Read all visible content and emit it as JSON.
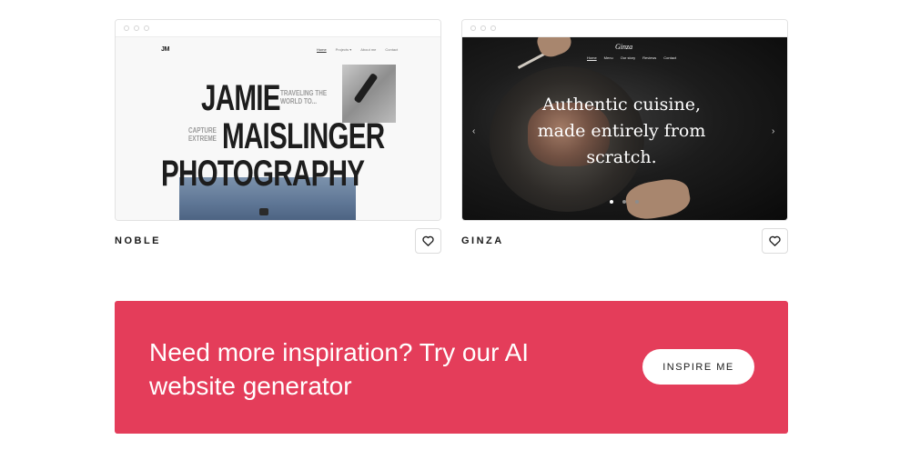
{
  "templates": [
    {
      "name": "NOBLE",
      "preview": {
        "logo": "JM",
        "nav": [
          "Home",
          "Projects ▾",
          "About me",
          "Contact"
        ],
        "title_lines": [
          "JAMIE",
          "MAISLINGER",
          "PHOTOGRAPHY"
        ],
        "tagline_1": "TRAVELING THE WORLD TO...",
        "tagline_2": "CAPTURE EXTREME"
      }
    },
    {
      "name": "GINZA",
      "preview": {
        "logo": "Ginza",
        "nav": [
          "Home",
          "Menu",
          "Our story",
          "Reviews",
          "Contact"
        ],
        "headline": "Authentic cuisine, made entirely from scratch.",
        "prev_arrow": "‹",
        "next_arrow": "›"
      }
    }
  ],
  "banner": {
    "text": "Need more inspiration? Try our AI website generator",
    "button_label": "INSPIRE ME",
    "background": "#e43d5a"
  }
}
